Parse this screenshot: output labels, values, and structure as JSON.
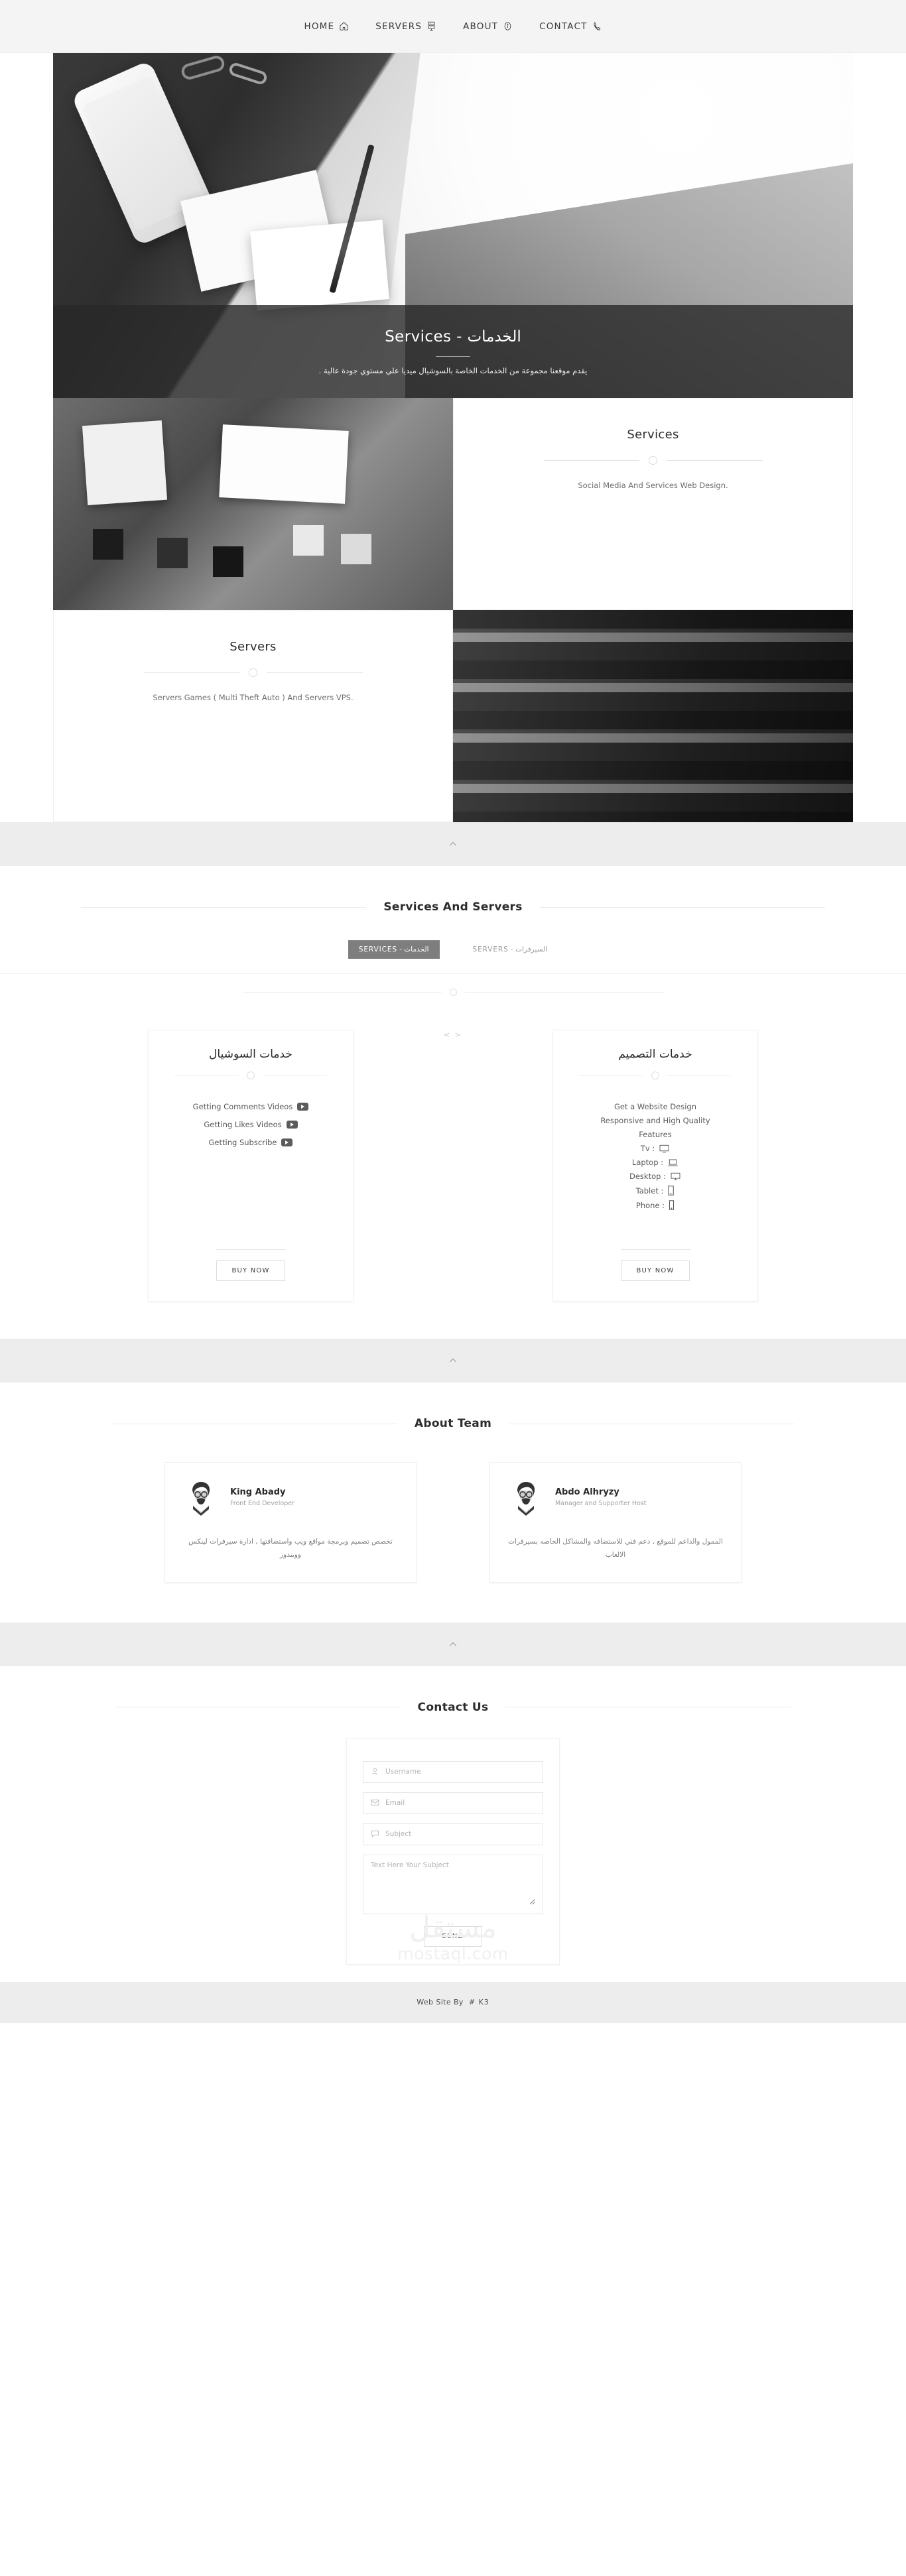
{
  "nav": {
    "items": [
      {
        "label": "HOME",
        "icon": "home-icon"
      },
      {
        "label": "SERVERS",
        "icon": "server-icon"
      },
      {
        "label": "ABOUT",
        "icon": "info-icon"
      },
      {
        "label": "CONTACT",
        "icon": "phone-icon"
      }
    ]
  },
  "hero": {
    "banner_title": "Services - الخدمات",
    "banner_subtitle": "يقدم موقعنا مجموعة من الخدمات الخاصة بالسوشيال ميديا علي مستوي جودة عالية ."
  },
  "features": [
    {
      "title": "Services",
      "description": "Social Media And Services Web Design.",
      "image": "social-media-photo",
      "image_side": "left"
    },
    {
      "title": "Servers",
      "description": "Servers Games ( Multi Theft Auto ) And Servers VPS.",
      "image": "server-rack-photo",
      "image_side": "right"
    }
  ],
  "scroll_up_icon": "chevron-up-icon",
  "services_section": {
    "heading": "Services And Servers",
    "tabs": [
      {
        "label": "الخدمات - SERVICES",
        "active": true
      },
      {
        "label": "السيرفرات - SERVERS",
        "active": false
      }
    ],
    "code_mark": "< >",
    "cards": [
      {
        "title": "خدمات السوشيال",
        "features": [
          {
            "label": "Getting Comments Videos",
            "icon": "youtube-icon"
          },
          {
            "label": "Getting Likes Videos",
            "icon": "youtube-icon"
          },
          {
            "label": "Getting Subscribe",
            "icon": "youtube-icon"
          }
        ],
        "buy_label": "BUY NOW"
      },
      {
        "title": "خدمات التصميم",
        "lines": [
          "Get a Website Design",
          "Responsive and High Quality",
          "Features"
        ],
        "devices": [
          {
            "label": "Tv :",
            "icon": "tv-icon"
          },
          {
            "label": "Laptop :",
            "icon": "laptop-icon"
          },
          {
            "label": "Desktop :",
            "icon": "desktop-icon"
          },
          {
            "label": "Tablet :",
            "icon": "tablet-icon"
          },
          {
            "label": "Phone :",
            "icon": "phone-device-icon"
          }
        ],
        "buy_label": "BUY NOW"
      }
    ]
  },
  "team_section": {
    "heading": "About Team",
    "members": [
      {
        "name": "King Abady",
        "role": "Front End Developer",
        "description": "تخصص تصميم وبرمجة مواقع ويب واستضافتها , ادارة سيرفرات لينكس وويندوز",
        "avatar": "bearded-man-avatar"
      },
      {
        "name": "Abdo Alhryzy",
        "role": "Manager and Supporter Host",
        "description": "الممول والداعم للموقع , دعم فني للاستضافه والمشاكل الخاصه بسيرفرات الالعاب",
        "avatar": "bearded-man-avatar"
      }
    ]
  },
  "contact_section": {
    "heading": "Contact Us",
    "fields": [
      {
        "name": "username",
        "placeholder": "Username",
        "value": "",
        "icon": "user-icon"
      },
      {
        "name": "email",
        "placeholder": "Email",
        "value": "",
        "icon": "envelope-icon"
      },
      {
        "name": "subject",
        "placeholder": "Subject",
        "value": "",
        "icon": "comment-icon"
      }
    ],
    "message": {
      "placeholder": "Text Here Your Subject",
      "value": ""
    },
    "send_label": "SEND",
    "watermark_ar": "مستقل",
    "watermark_en": "mostaql.com"
  },
  "footer": {
    "text": "Web Site By",
    "brand": "# K3"
  },
  "colors": {
    "band": "#ededed",
    "tab_active_bg": "#7e7e7e",
    "banner_overlay": "rgba(40,40,40,.80)",
    "text_dark": "#2d2d2d",
    "text_muted": "#7d7d7d"
  }
}
